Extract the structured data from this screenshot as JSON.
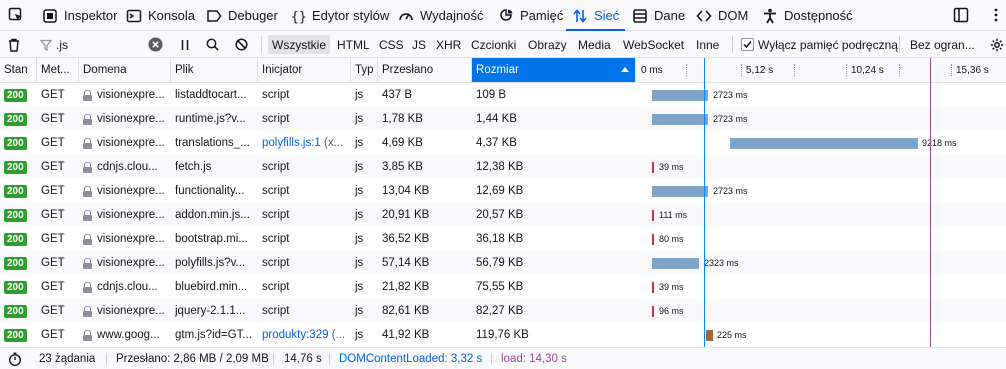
{
  "toolbar": {
    "tools": [
      {
        "label": "Inspektor",
        "icon": "inspector-icon"
      },
      {
        "label": "Konsola",
        "icon": "console-icon"
      },
      {
        "label": "Debuger",
        "icon": "debugger-icon"
      },
      {
        "label": "Edytor stylów",
        "icon": "style-editor-icon"
      },
      {
        "label": "Wydajność",
        "icon": "performance-icon"
      },
      {
        "label": "Pamięć",
        "icon": "memory-icon"
      },
      {
        "label": "Sieć",
        "icon": "network-icon",
        "active": true
      },
      {
        "label": "Dane",
        "icon": "storage-icon"
      },
      {
        "label": "DOM",
        "icon": "dom-icon"
      },
      {
        "label": "Dostępność",
        "icon": "accessibility-icon"
      }
    ]
  },
  "filter": {
    "value": ".js",
    "types": [
      "Wszystkie",
      "HTML",
      "CSS",
      "JS",
      "XHR",
      "Czcionki",
      "Obrazy",
      "Media",
      "WebSocket",
      "Inne"
    ],
    "active_type": "Wszystkie",
    "disable_cache_label": "Wyłącz pamięć podręczną",
    "disable_cache_checked": true,
    "throttle_label": "Bez ogran..."
  },
  "columns": {
    "status": "Stan",
    "method": "Met...",
    "domain": "Domena",
    "file": "Plik",
    "initiator": "Inicjator",
    "type": "Typ",
    "transferred": "Przesłano",
    "size": "Rozmiar",
    "timeline_ticks": [
      "0 ms",
      "5,12 s",
      "10,24 s",
      "15,36 s"
    ]
  },
  "requests": [
    {
      "status": "200",
      "method": "GET",
      "domain": "visionexpre...",
      "file": "listaddtocart...",
      "initiator": "script",
      "initiator_extra": "",
      "type": "js",
      "transferred": "437 B",
      "size": "109 B",
      "timing": "2723 ms"
    },
    {
      "status": "200",
      "method": "GET",
      "domain": "visionexpre...",
      "file": "runtime.js?v...",
      "initiator": "script",
      "initiator_extra": "",
      "type": "js",
      "transferred": "1,78 KB",
      "size": "1,44 KB",
      "timing": "2723 ms"
    },
    {
      "status": "200",
      "method": "GET",
      "domain": "visionexpre...",
      "file": "translations_...",
      "initiator": "polyfills.js:1",
      "initiator_extra": "(x...",
      "type": "js",
      "transferred": "4,69 KB",
      "size": "4,37 KB",
      "timing": "9218 ms"
    },
    {
      "status": "200",
      "method": "GET",
      "domain": "cdnjs.clou...",
      "file": "fetch.js",
      "initiator": "script",
      "initiator_extra": "",
      "type": "js",
      "transferred": "3,85 KB",
      "size": "12,38 KB",
      "timing": "39 ms"
    },
    {
      "status": "200",
      "method": "GET",
      "domain": "visionexpre...",
      "file": "functionality...",
      "initiator": "script",
      "initiator_extra": "",
      "type": "js",
      "transferred": "13,04 KB",
      "size": "12,69 KB",
      "timing": "2723 ms"
    },
    {
      "status": "200",
      "method": "GET",
      "domain": "visionexpre...",
      "file": "addon.min.js...",
      "initiator": "script",
      "initiator_extra": "",
      "type": "js",
      "transferred": "20,91 KB",
      "size": "20,57 KB",
      "timing": "111 ms"
    },
    {
      "status": "200",
      "method": "GET",
      "domain": "visionexpre...",
      "file": "bootstrap.mi...",
      "initiator": "script",
      "initiator_extra": "",
      "type": "js",
      "transferred": "36,52 KB",
      "size": "36,18 KB",
      "timing": "80 ms"
    },
    {
      "status": "200",
      "method": "GET",
      "domain": "visionexpre...",
      "file": "polyfills.js?v...",
      "initiator": "script",
      "initiator_extra": "",
      "type": "js",
      "transferred": "57,14 KB",
      "size": "56,79 KB",
      "timing": "2323 ms"
    },
    {
      "status": "200",
      "method": "GET",
      "domain": "cdnjs.clou...",
      "file": "bluebird.min...",
      "initiator": "script",
      "initiator_extra": "",
      "type": "js",
      "transferred": "21,82 KB",
      "size": "75,55 KB",
      "timing": "39 ms"
    },
    {
      "status": "200",
      "method": "GET",
      "domain": "visionexpre...",
      "file": "jquery-2.1.1...",
      "initiator": "script",
      "initiator_extra": "",
      "type": "js",
      "transferred": "82,61 KB",
      "size": "82,27 KB",
      "timing": "96 ms"
    },
    {
      "status": "200",
      "method": "GET",
      "domain": "www.goog...",
      "file": "gtm.js?id=GT...",
      "initiator": "produkty:329",
      "initiator_extra": "(...",
      "type": "js",
      "transferred": "41,92 KB",
      "size": "119,76 KB",
      "timing": "225 ms"
    }
  ],
  "summary": {
    "requests": "23 żądania",
    "transferred": "Przesłano: 2,86 MB / 2,09 MB",
    "finish": "14,76 s",
    "dom_loaded": "DOMContentLoaded: 3,32 s",
    "load": "load: 14,30 s"
  },
  "colors": {
    "accent": "#0061e0",
    "status_ok": "#2f9e2f",
    "waterfall_bar": "#7fa4c4",
    "dom_line": "#0a84ff",
    "load_line": "#a4479e"
  }
}
